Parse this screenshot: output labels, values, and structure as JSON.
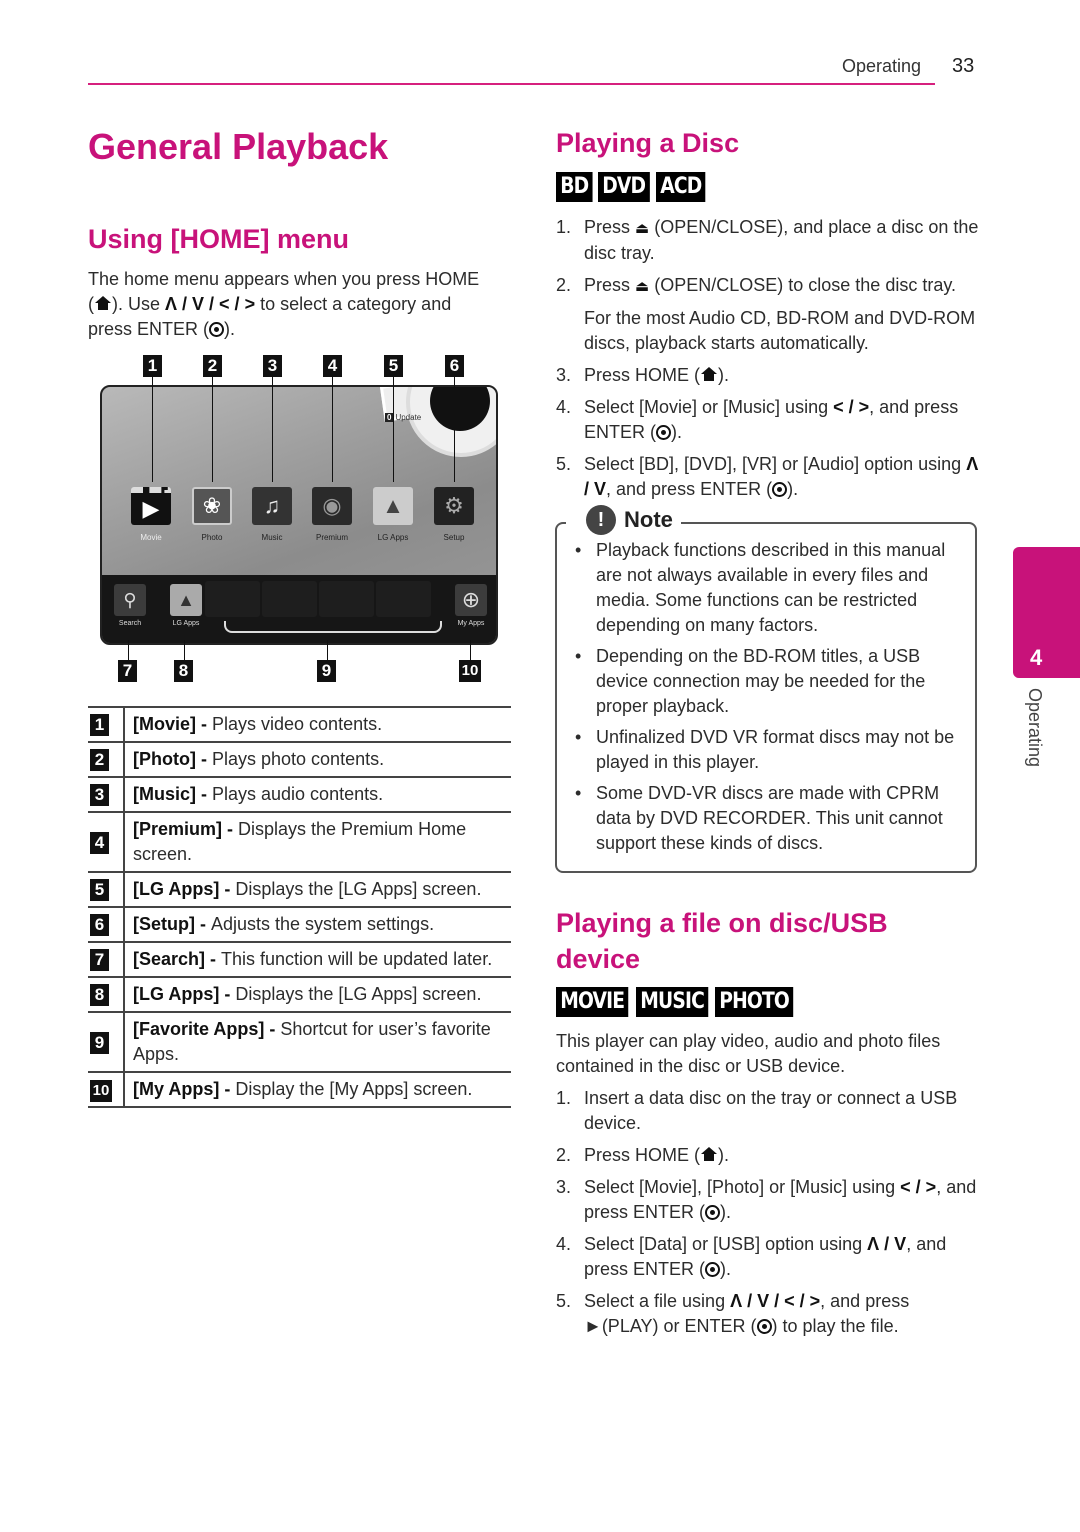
{
  "header": {
    "section": "Operating",
    "page_number": "33"
  },
  "title": "General Playback",
  "home_menu": {
    "heading": "Using [HOME] menu",
    "intro": {
      "part1": "The home menu appears when you press HOME",
      "part2": "). Use",
      "nav_keys": "Λ / V / < / >",
      "part3": "to select a category and",
      "part4": "press ENTER (",
      "part5": ")."
    },
    "top_callouts": [
      "1",
      "2",
      "3",
      "4",
      "5",
      "6"
    ],
    "bottom_callouts": [
      "7",
      "8",
      "9",
      "10"
    ],
    "screen": {
      "update_badge": "0",
      "update_label": "Update",
      "tiles": [
        {
          "label": "Movie",
          "icon": "movie-clapper-icon",
          "selected": true
        },
        {
          "label": "Photo",
          "icon": "flower-photo-icon",
          "selected": false
        },
        {
          "label": "Music",
          "icon": "music-note-icon",
          "selected": false
        },
        {
          "label": "Premium",
          "icon": "globe-icon",
          "selected": false
        },
        {
          "label": "LG Apps",
          "icon": "lg-apps-icon",
          "selected": false
        },
        {
          "label": "Setup",
          "icon": "gear-icon",
          "selected": false
        }
      ],
      "bottom_bar": [
        {
          "label": "Search",
          "icon": "search-icon"
        },
        {
          "label": "LG Apps",
          "icon": "lg-apps-icon"
        },
        {
          "label": "My Apps",
          "icon": "plus-circle-icon"
        }
      ]
    },
    "legend": [
      {
        "num": "1",
        "term": "[Movie]",
        "desc": "Plays video contents."
      },
      {
        "num": "2",
        "term": "[Photo]",
        "desc": "Plays photo contents."
      },
      {
        "num": "3",
        "term": "[Music]",
        "desc": "Plays audio contents."
      },
      {
        "num": "4",
        "term": "[Premium]",
        "desc": "Displays the Premium Home screen."
      },
      {
        "num": "5",
        "term": "[LG Apps]",
        "desc": "Displays the [LG Apps] screen."
      },
      {
        "num": "6",
        "term": "[Setup]",
        "desc": "Adjusts the system settings."
      },
      {
        "num": "7",
        "term": "[Search]",
        "desc": "This function will be updated later."
      },
      {
        "num": "8",
        "term": "[LG Apps]",
        "desc": "Displays the [LG Apps] screen."
      },
      {
        "num": "9",
        "term": "[Favorite Apps]",
        "desc": "Shortcut for user’s favorite Apps."
      },
      {
        "num": "10",
        "term": "[My Apps]",
        "desc": "Display the [My Apps] screen."
      }
    ],
    "separator": " - "
  },
  "playing_disc": {
    "heading": "Playing a Disc",
    "tags": [
      "BD",
      "DVD",
      "ACD"
    ],
    "steps": [
      {
        "num": "1.",
        "a": "Press",
        "b": "(OPEN/CLOSE), and place a disc on the disc tray."
      },
      {
        "num": "2.",
        "a": "Press",
        "b": "(OPEN/CLOSE) to close the disc tray."
      },
      {
        "num": "",
        "a": "For the most Audio CD, BD-ROM and DVD-ROM discs, playback starts automatically."
      },
      {
        "num": "3.",
        "a": "Press HOME (",
        "b": ")."
      },
      {
        "num": "4.",
        "a": "Select [Movie] or [Music] using",
        "keys": "< / >",
        "b": ", and press ENTER (",
        "c": ")."
      },
      {
        "num": "5.",
        "a": "Select [BD], [DVD], [VR] or [Audio] option using",
        "keys": "Λ / V",
        "b": ", and press ENTER (",
        "c": ")."
      }
    ]
  },
  "note": {
    "title": "Note",
    "items": [
      "Playback functions described in this manual are not always available in every files and media. Some functions can be restricted depending on many factors.",
      "Depending on the BD-ROM titles, a USB device connection may be needed for the proper playback.",
      "Unfinalized DVD VR format discs may not be played in this player.",
      "Some DVD-VR discs are made with CPRM data by DVD RECORDER. This unit cannot support these kinds of discs."
    ]
  },
  "playing_file": {
    "heading": "Playing a file on disc/USB device",
    "tags": [
      "MOVIE",
      "MUSIC",
      "PHOTO"
    ],
    "intro": "This player can play video, audio and photo files contained in the disc or USB device.",
    "steps": [
      {
        "num": "1.",
        "a": "Insert a data disc on the tray or connect a USB device."
      },
      {
        "num": "2.",
        "a": "Press HOME (",
        "b": ")."
      },
      {
        "num": "3.",
        "a": "Select [Movie], [Photo] or [Music] using",
        "keys": "< / >",
        "b": ", and press ENTER (",
        "c": ")."
      },
      {
        "num": "4.",
        "a": "Select [Data] or [USB] option using",
        "keys": "Λ / V",
        "b": ", and press ENTER (",
        "c": ")."
      },
      {
        "num": "5.",
        "a": "Select a file using",
        "keys": "Λ / V / < / >",
        "b": ", and press ►(PLAY) or ENTER (",
        "c": ") to play the file."
      }
    ]
  },
  "side_tab": {
    "chapter": "4",
    "label": "Operating"
  },
  "colors": {
    "accent": "#c8127a",
    "text": "#2c2c2c"
  }
}
